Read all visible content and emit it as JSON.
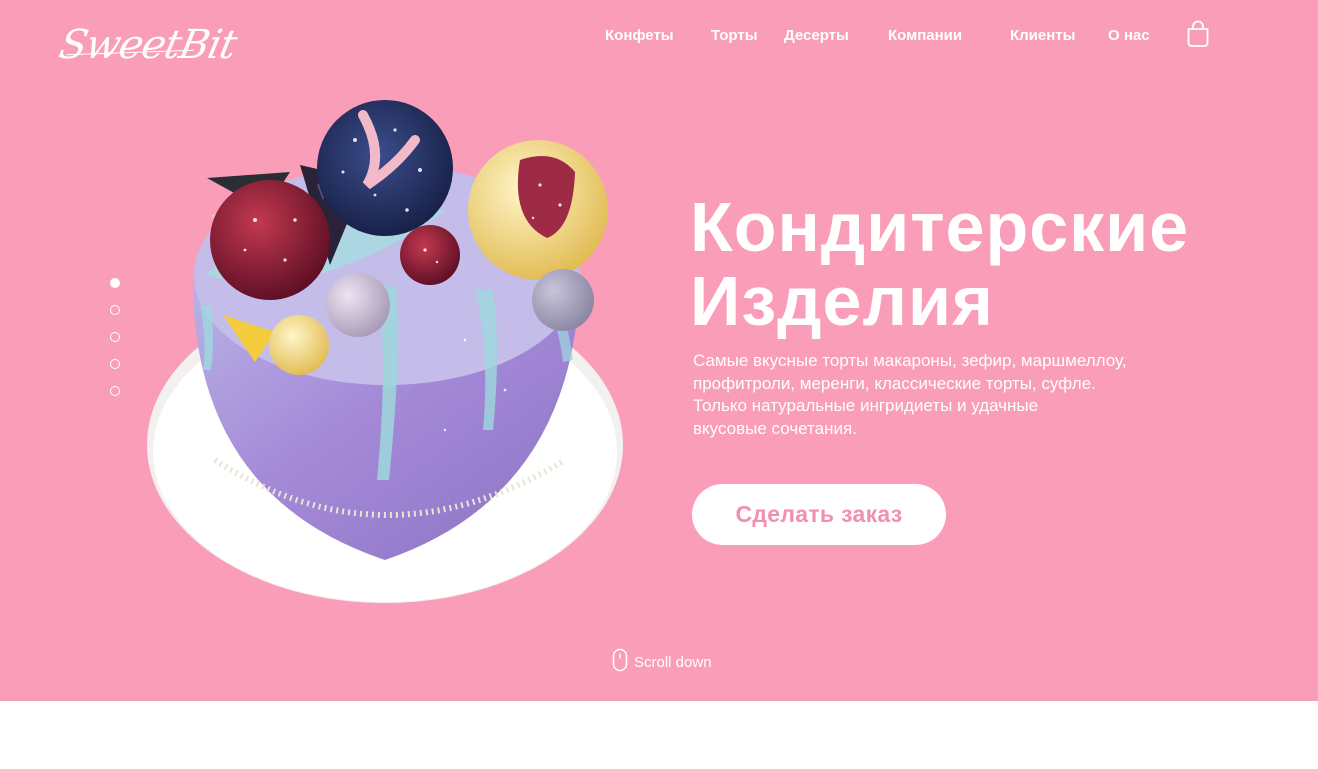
{
  "logo": {
    "text": "SweetBit"
  },
  "nav": {
    "items": [
      {
        "label": "Конфеты"
      },
      {
        "label": "Торты"
      },
      {
        "label": "Десерты"
      },
      {
        "label": "Компании"
      },
      {
        "label": "Клиенты"
      },
      {
        "label": "О нас"
      }
    ],
    "cart_icon": "shopping-bag-icon"
  },
  "slider": {
    "count": 5,
    "active_index": 0
  },
  "hero": {
    "title_line1": "Кондитерские",
    "title_line2": "Изделия",
    "description": [
      "Самые вкусные торты макароны, зефир, маршмеллоу,",
      "профитроли, меренги, классические торты, суфле.",
      "Только натуральные ингридиеты и удачные",
      "вкусовые сочетания."
    ],
    "cta_label": "Сделать заказ",
    "image_icon": "cake-image"
  },
  "scroll": {
    "label": "Scroll down",
    "icon": "mouse-icon"
  },
  "colors": {
    "hero_background": "#fa9db8",
    "accent_text": "#f08fb0",
    "foreground": "#ffffff"
  }
}
